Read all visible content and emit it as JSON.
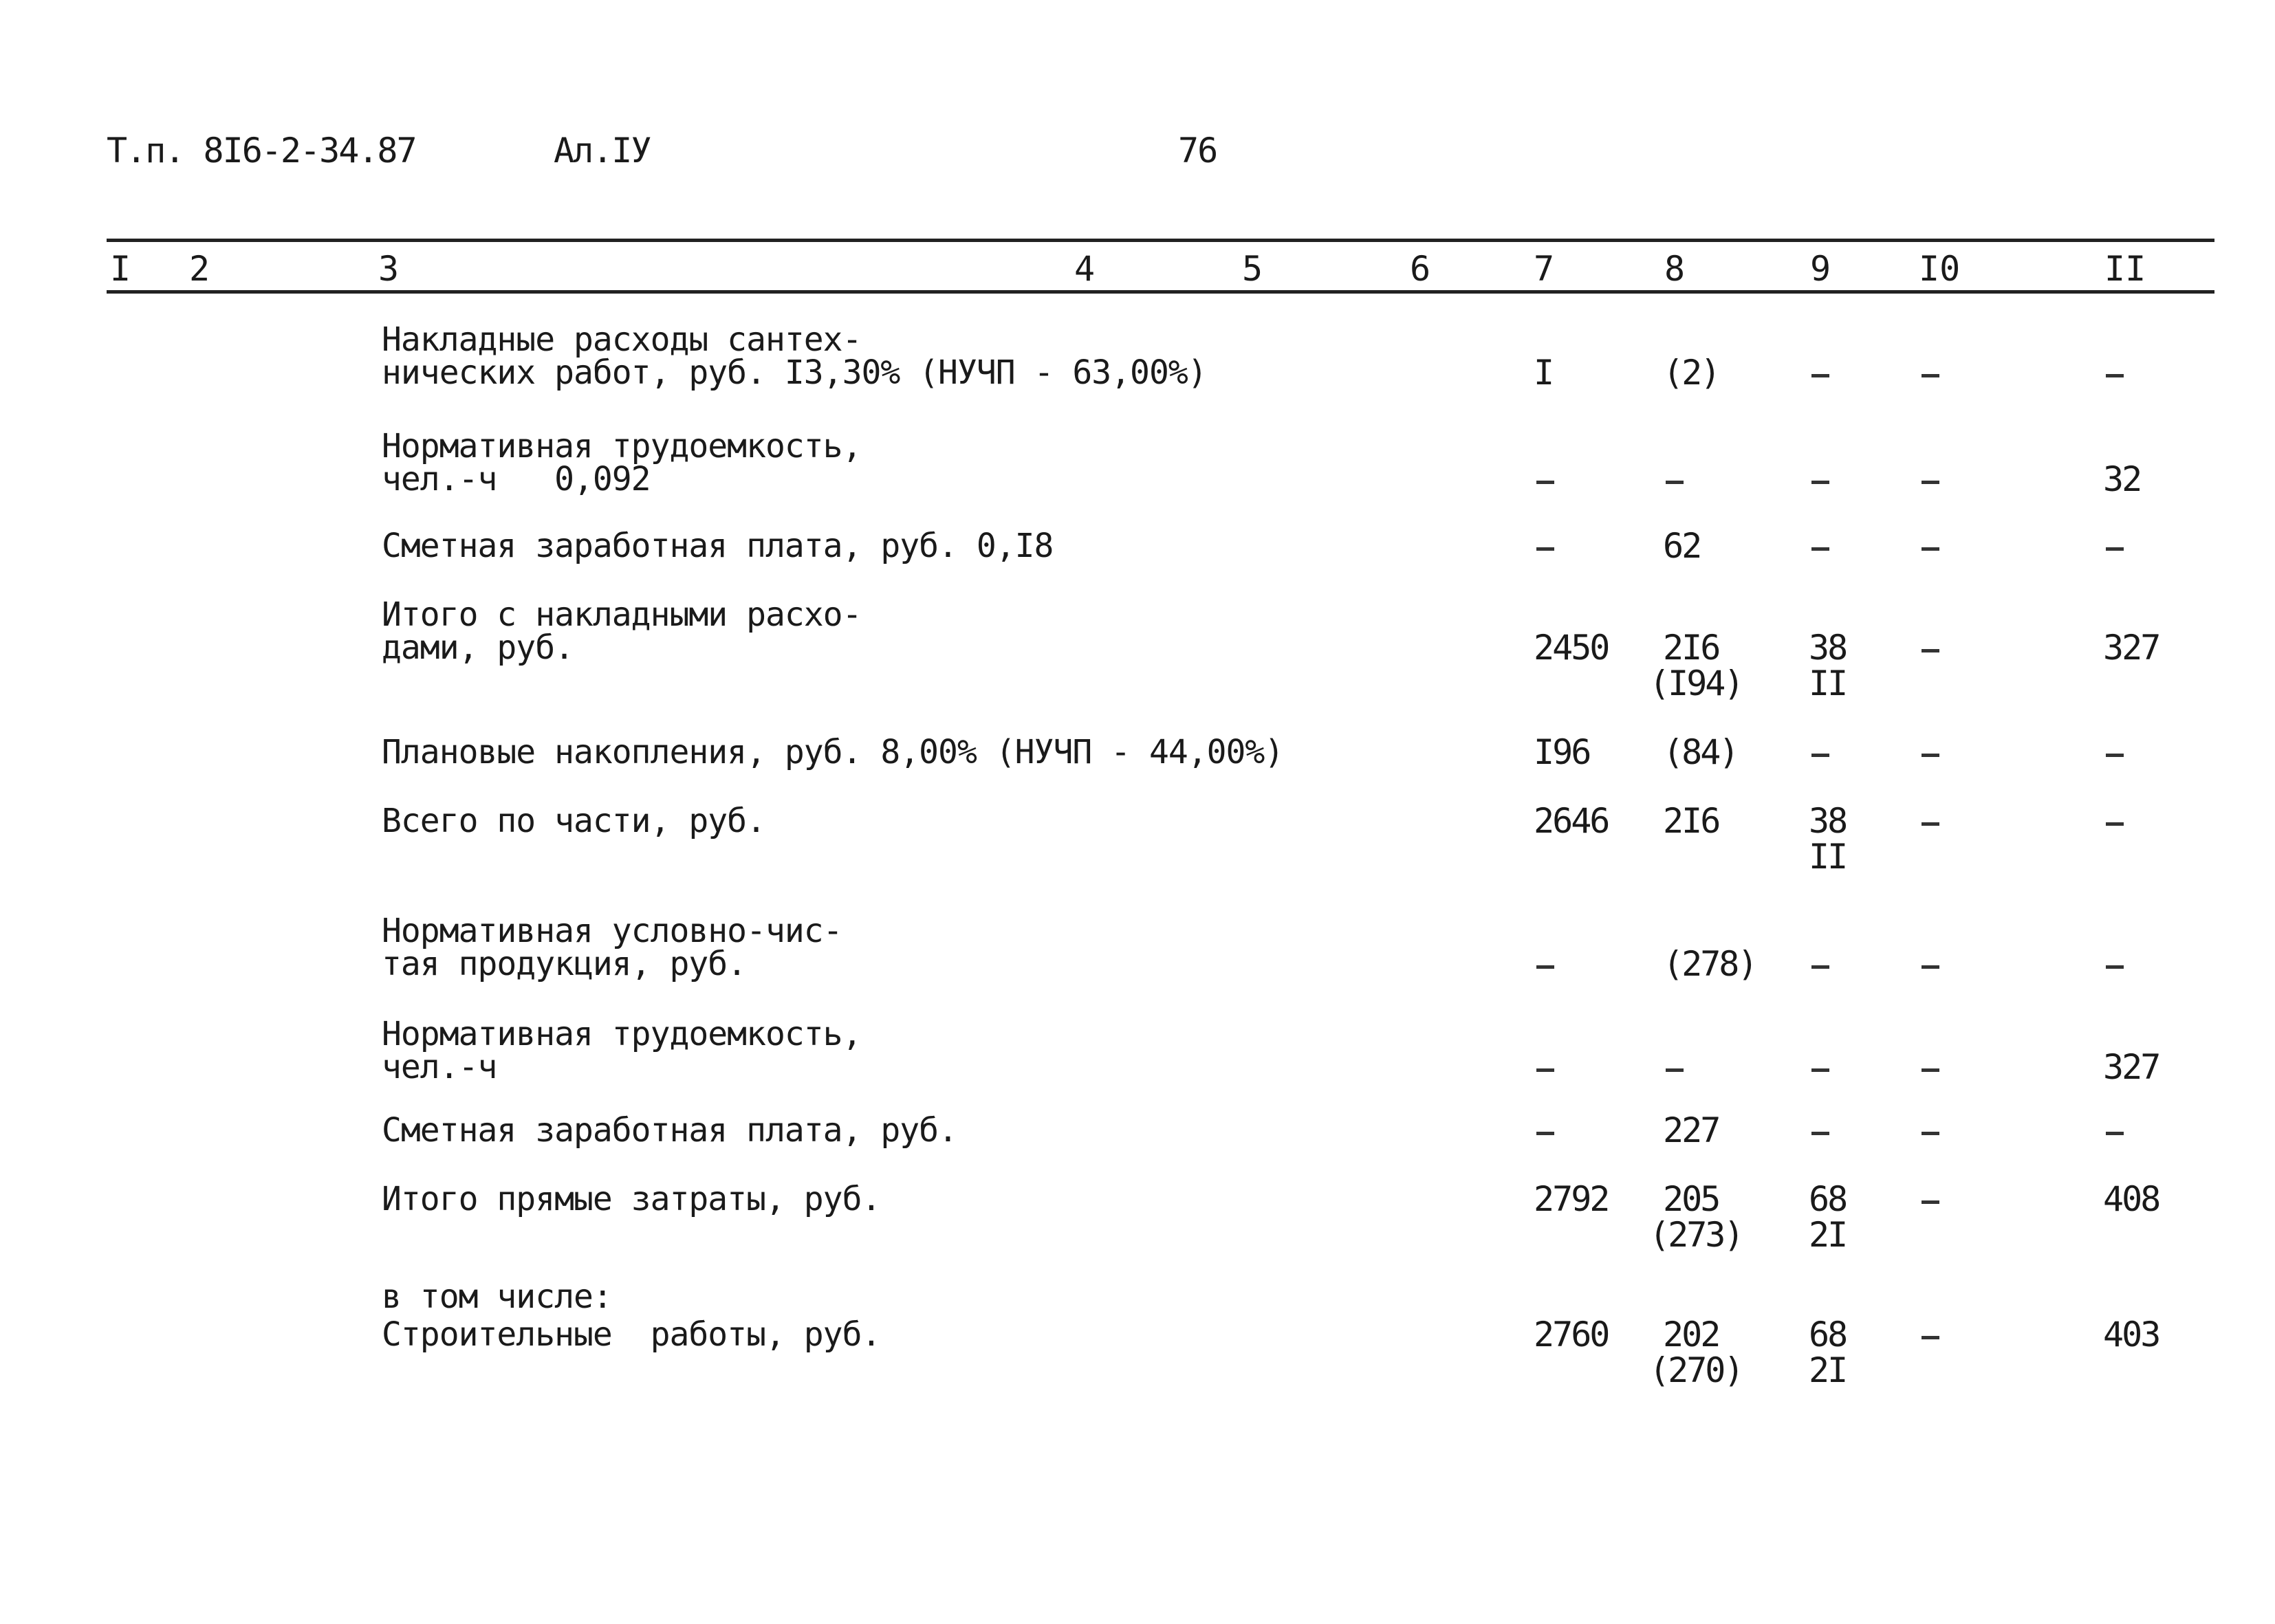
{
  "header": {
    "doc_code": "Т.п. 8I6-2-34.87",
    "album": "Ал.IУ",
    "page_number": "76"
  },
  "columns": [
    "I",
    "2",
    "3",
    "4",
    "5",
    "6",
    "7",
    "8",
    "9",
    "I0",
    "II"
  ],
  "rows": [
    {
      "label": [
        "Накладные расходы сантех-",
        "нических работ, руб. I3,30% (НУЧП - 63,00%)"
      ],
      "c7": "I",
      "c8": [
        "(2)"
      ],
      "c9": [
        "–"
      ],
      "c10": "–",
      "c11": "–"
    },
    {
      "label": [
        "Нормативная трудоемкость,",
        "чел.-ч   0,092"
      ],
      "c7": "–",
      "c8": [
        "–"
      ],
      "c9": [
        "–"
      ],
      "c10": "–",
      "c11": "32"
    },
    {
      "label": [
        "Сметная заработная плата, руб. 0,I8"
      ],
      "c7": "–",
      "c8": [
        "62"
      ],
      "c9": [
        "–"
      ],
      "c10": "–",
      "c11": "–"
    },
    {
      "label": [
        "Итого с накладными расхо-",
        "дами, руб."
      ],
      "c7": "2450",
      "c8": [
        "2I6",
        "(I94)"
      ],
      "c9": [
        "38",
        "II"
      ],
      "c10": "–",
      "c11": "327"
    },
    {
      "label": [
        "Плановые накопления, руб. 8,00% (НУЧП - 44,00%)"
      ],
      "c7": "I96",
      "c8": [
        "(84)"
      ],
      "c9": [
        "–"
      ],
      "c10": "–",
      "c11": "–"
    },
    {
      "label": [
        "Всего по части, руб."
      ],
      "c7": "2646",
      "c8": [
        "2I6"
      ],
      "c9": [
        "38",
        "II"
      ],
      "c10": "–",
      "c11": "–"
    },
    {
      "label": [
        "Нормативная условно-чис-",
        "тая продукция, руб."
      ],
      "c7": "–",
      "c8": [
        "(278)"
      ],
      "c9": [
        "–"
      ],
      "c10": "–",
      "c11": "–"
    },
    {
      "label": [
        "Нормативная трудоемкость,",
        "чел.-ч"
      ],
      "c7": "–",
      "c8": [
        "–"
      ],
      "c9": [
        "–"
      ],
      "c10": "–",
      "c11": "327"
    },
    {
      "label": [
        "Сметная заработная плата, руб."
      ],
      "c7": "–",
      "c8": [
        "227"
      ],
      "c9": [
        "–"
      ],
      "c10": "–",
      "c11": "–"
    },
    {
      "label": [
        "Итого прямые затраты, руб."
      ],
      "c7": "2792",
      "c8": [
        "205",
        "(273)"
      ],
      "c9": [
        "68",
        "2I"
      ],
      "c10": "–",
      "c11": "408"
    },
    {
      "label": [
        "в том числе:"
      ],
      "c7": "",
      "c8": [
        ""
      ],
      "c9": [
        ""
      ],
      "c10": "",
      "c11": ""
    },
    {
      "label": [
        "Строительные  работы, руб."
      ],
      "c7": "2760",
      "c8": [
        "202",
        "(270)"
      ],
      "c9": [
        "68",
        "2I"
      ],
      "c10": "–",
      "c11": "403"
    }
  ]
}
